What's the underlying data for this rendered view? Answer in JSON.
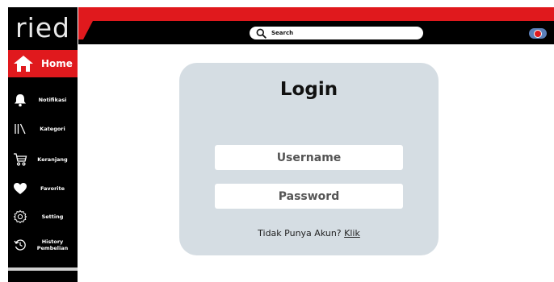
{
  "sidebar": {
    "logo": "ried",
    "home_label": "Home",
    "items": [
      {
        "label": "Notifikasi",
        "icon": "bell-icon"
      },
      {
        "label": "Kategori",
        "icon": "books-icon"
      },
      {
        "label": "Keranjang",
        "icon": "cart-icon"
      },
      {
        "label": "Favorite",
        "icon": "heart-icon"
      },
      {
        "label": "Setting",
        "icon": "gear-icon"
      },
      {
        "label": "History Pembelian",
        "icon": "history-icon"
      }
    ]
  },
  "header": {
    "search_label": "Search"
  },
  "login": {
    "title": "Login",
    "username_label": "Username",
    "password_label": "Password",
    "signup_prompt": "Tidak Punya Akun?",
    "signup_link": "Klik"
  },
  "colors": {
    "accent": "#e0191d",
    "sidebar": "#000000",
    "card": "#d5dde3"
  }
}
